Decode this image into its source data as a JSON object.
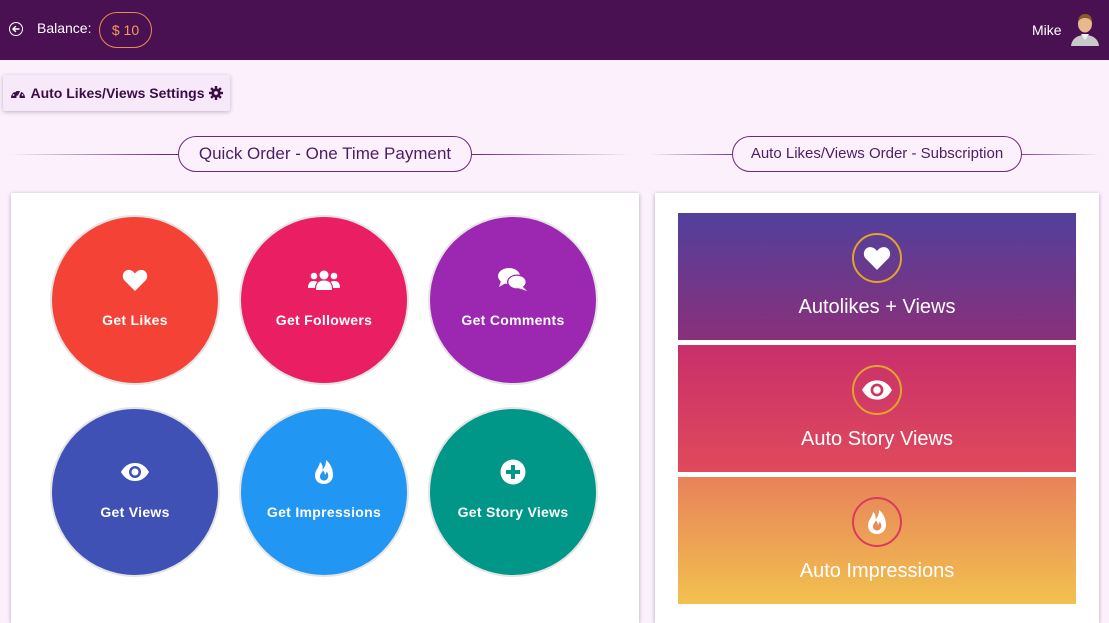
{
  "header": {
    "balance_label": "Balance:",
    "balance_value": "$ 10",
    "username": "Mike",
    "background": "#4a1152"
  },
  "settings_button": {
    "label": "Auto Likes/Views Settings",
    "icon": "dashboard-icon",
    "trailing_icon": "gear-icon"
  },
  "sections": {
    "quick_order": "Quick Order - One Time Payment",
    "subscription": "Auto Likes/Views Order - Subscription"
  },
  "quick_order_items": [
    {
      "label": "Get Likes",
      "icon": "heart-icon",
      "color": "#f44336"
    },
    {
      "label": "Get Followers",
      "icon": "users-icon",
      "color": "#e91e63"
    },
    {
      "label": "Get Comments",
      "icon": "comments-icon",
      "color": "#9c27b0"
    },
    {
      "label": "Get Views",
      "icon": "eye-icon",
      "color": "#3f51b5"
    },
    {
      "label": "Get Impressions",
      "icon": "fire-icon",
      "color": "#2196f3"
    },
    {
      "label": "Get Story Views",
      "icon": "plus-circle-icon",
      "color": "#009688"
    }
  ],
  "subscription_items": [
    {
      "label": "Autolikes + Views",
      "icon": "heart-icon"
    },
    {
      "label": "Auto Story Views",
      "icon": "eye-icon"
    },
    {
      "label": "Auto Impressions",
      "icon": "fire-icon"
    }
  ]
}
